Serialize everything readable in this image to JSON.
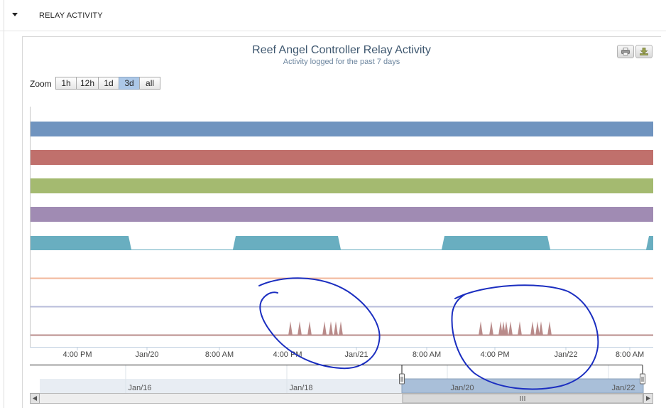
{
  "section": {
    "title": "RELAY ACTIVITY"
  },
  "chart_data": {
    "type": "area",
    "title": "Reef Angel Controller Relay Activity",
    "subtitle": "Activity logged for the past 7 days",
    "zoom": {
      "label": "Zoom",
      "options": [
        "1h",
        "12h",
        "1d",
        "3d",
        "all"
      ],
      "selected": "3d"
    },
    "x_ticks": [
      "4:00 PM",
      "Jan/20",
      "8:00 AM",
      "4:00 PM",
      "Jan/21",
      "8:00 AM",
      "4:00 PM",
      "Jan/22",
      "8:00 AM"
    ],
    "navigator_ticks": [
      "Jan/16",
      "Jan/18",
      "Jan/20",
      "Jan/22"
    ],
    "relays": [
      {
        "color": "#7094bf",
        "state": "on"
      },
      {
        "color": "#c0706c",
        "state": "on"
      },
      {
        "color": "#a4ba70",
        "state": "on"
      },
      {
        "color": "#a08bb3",
        "state": "on"
      },
      {
        "color": "#69aec0",
        "state": "cycling"
      },
      {
        "color": "#f2b79b",
        "state": "off"
      },
      {
        "color": "#b8bcda",
        "state": "off"
      },
      {
        "color": "#b98b8a",
        "state": "pulses"
      }
    ],
    "annotation": {
      "color": "#1b2ec0",
      "shape": "hand-drawn circles"
    }
  },
  "icons": {
    "print": "print-icon",
    "download": "download-icon"
  }
}
